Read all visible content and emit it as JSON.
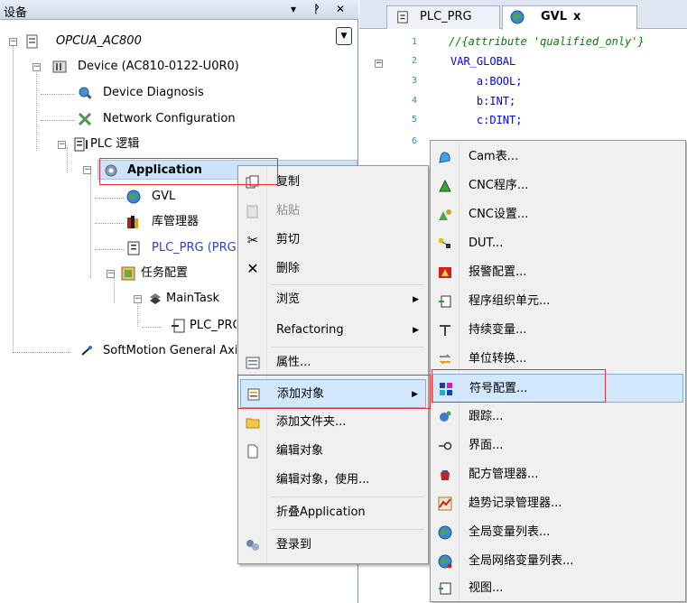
{
  "devices_panel": {
    "title": "设备",
    "tree": [
      {
        "label": "OPCUA_AC800",
        "italic": true
      },
      {
        "label": "Device (AC810-0122-U0R0)"
      },
      {
        "label": "Device Diagnosis"
      },
      {
        "label": "Network Configuration"
      },
      {
        "label": "PLC 逻辑"
      },
      {
        "label": "Application",
        "selected": true
      },
      {
        "label": "GVL"
      },
      {
        "label": "库管理器"
      },
      {
        "label": "PLC_PRG (PRG)"
      },
      {
        "label": "任务配置"
      },
      {
        "label": "MainTask"
      },
      {
        "label": "PLC_PRG"
      },
      {
        "label": "SoftMotion General Axis Pool"
      }
    ]
  },
  "editor": {
    "tabs": [
      {
        "label": "PLC_PRG"
      },
      {
        "label": "GVL",
        "active": true,
        "close": "x"
      }
    ],
    "line_numbers": [
      "1",
      "2",
      "3",
      "4",
      "5",
      "6"
    ],
    "code": [
      "//{attribute 'qualified_only'}",
      "VAR_GLOBAL",
      "    a:BOOL;",
      "    b:INT;",
      "    c:DINT;",
      ""
    ]
  },
  "context_menu": {
    "items": [
      {
        "label": "复制",
        "icon": "copy-icon"
      },
      {
        "label": "粘贴",
        "icon": "paste-icon",
        "disabled": true
      },
      {
        "label": "剪切",
        "icon": "cut-icon"
      },
      {
        "label": "删除",
        "icon": "delete-icon"
      },
      {
        "label": "浏览",
        "submenu": true
      },
      {
        "label": "Refactoring",
        "submenu": true
      },
      {
        "label": "属性...",
        "icon": "properties-icon"
      },
      {
        "label": "添加对象",
        "icon": "add-object-icon",
        "submenu": true,
        "highlight": true
      },
      {
        "label": "添加文件夹...",
        "icon": "folder-icon"
      },
      {
        "label": "编辑对象",
        "icon": "edit-object-icon"
      },
      {
        "label": "编辑对象，使用..."
      },
      {
        "label": "折叠Application"
      },
      {
        "label": "登录到",
        "icon": "login-icon"
      }
    ]
  },
  "add_object_submenu": {
    "items": [
      {
        "label": "Cam表...",
        "icon": "cam-table-icon"
      },
      {
        "label": "CNC程序...",
        "icon": "cnc-program-icon"
      },
      {
        "label": "CNC设置...",
        "icon": "cnc-settings-icon"
      },
      {
        "label": "DUT...",
        "icon": "dut-icon"
      },
      {
        "label": "报警配置...",
        "icon": "alarm-config-icon"
      },
      {
        "label": "程序组织单元...",
        "icon": "pou-icon"
      },
      {
        "label": "持续变量...",
        "icon": "persistent-vars-icon"
      },
      {
        "label": "单位转换...",
        "icon": "unit-conversion-icon"
      },
      {
        "label": "符号配置...",
        "icon": "symbol-config-icon",
        "highlight": true
      },
      {
        "label": "跟踪...",
        "icon": "trace-icon"
      },
      {
        "label": "界面...",
        "icon": "interface-icon"
      },
      {
        "label": "配方管理器...",
        "icon": "recipe-manager-icon"
      },
      {
        "label": "趋势记录管理器...",
        "icon": "trend-recorder-icon"
      },
      {
        "label": "全局变量列表...",
        "icon": "gvl-icon"
      },
      {
        "label": "全局网络变量列表...",
        "icon": "network-gvl-icon"
      },
      {
        "label": "视图...",
        "icon": "visualization-icon"
      }
    ]
  },
  "colors": {
    "highlight_bg": "#d1e8ff",
    "highlight_border": "#84acdd",
    "annotation_red": "#e0343a",
    "code_blue": "#0000ff",
    "code_comment": "#008000"
  }
}
